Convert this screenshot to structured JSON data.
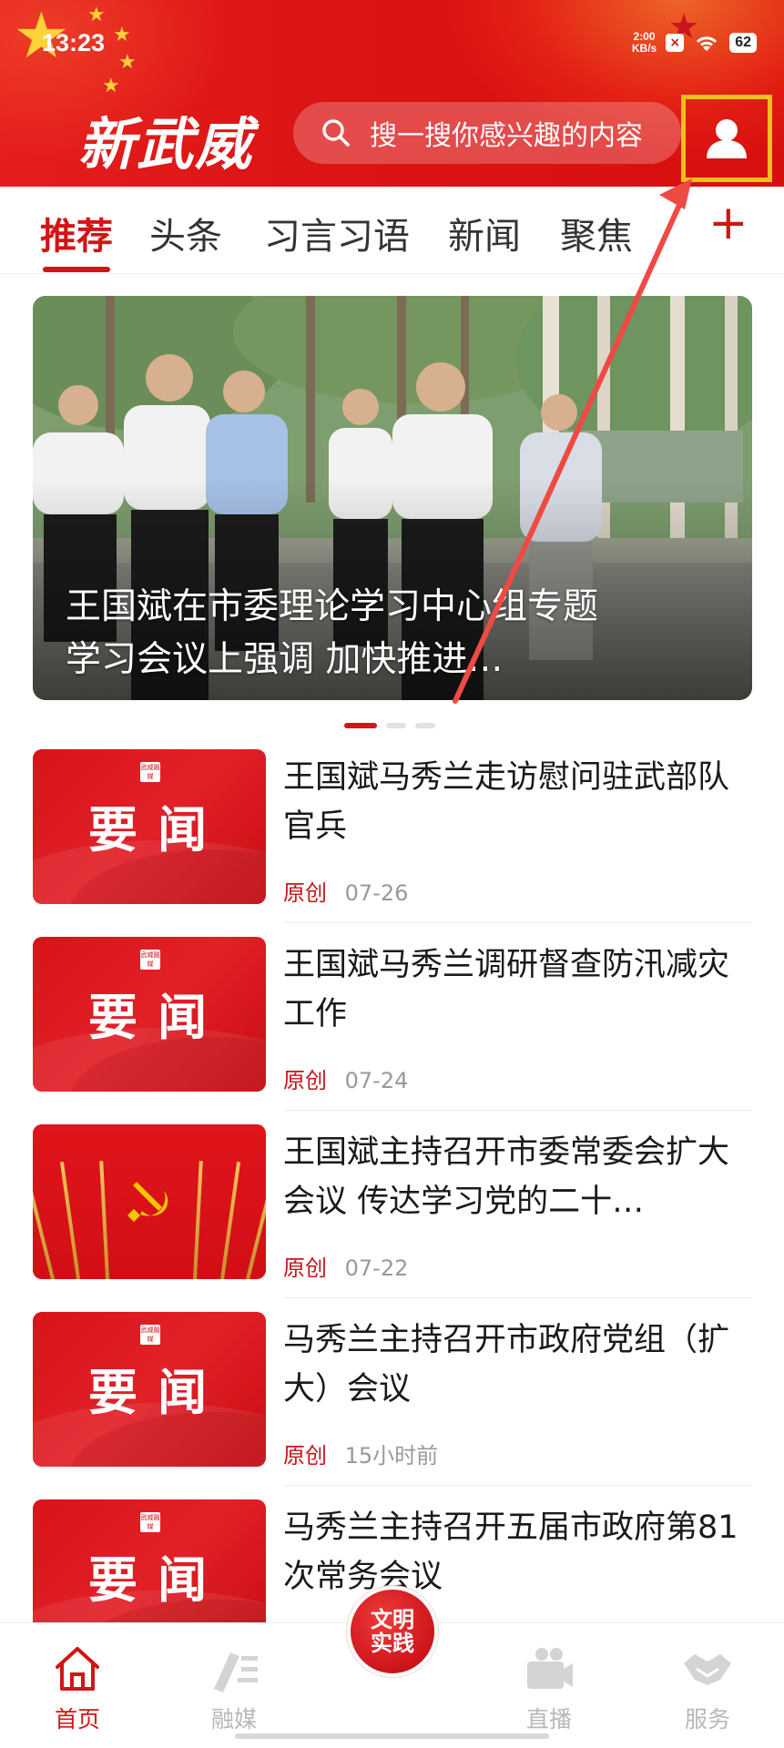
{
  "status_bar": {
    "time": "13:23",
    "network_speed_top": "2:00",
    "network_speed_unit": "KB/s",
    "battery": "62"
  },
  "header": {
    "logo_text": "新武威",
    "search_placeholder": "搜一搜你感兴趣的内容",
    "accent_color": "#d21515"
  },
  "tabs": [
    {
      "label": "推荐",
      "active": true
    },
    {
      "label": "头条",
      "active": false
    },
    {
      "label": "习言习语",
      "active": false
    },
    {
      "label": "新闻",
      "active": false
    },
    {
      "label": "聚焦",
      "active": false
    }
  ],
  "tabs_add_label": "+",
  "banner": {
    "title": "王国斌在市委理论学习中心组专题学习会议上强调  加快推进…",
    "page_index": 1,
    "page_count": 3
  },
  "news": [
    {
      "title": "王国斌马秀兰走访慰问驻武部队官兵",
      "source": "原创",
      "time": "07-26",
      "thumb_text": "要闻",
      "thumb_badge": "武威融媒",
      "thumb_type": "yaowen"
    },
    {
      "title": "王国斌马秀兰调研督查防汛减灾工作",
      "source": "原创",
      "time": "07-24",
      "thumb_text": "要闻",
      "thumb_badge": "武威融媒",
      "thumb_type": "yaowen"
    },
    {
      "title": "王国斌主持召开市委常委会扩大会议  传达学习党的二十…",
      "source": "原创",
      "time": "07-22",
      "thumb_text": "",
      "thumb_badge": "",
      "thumb_type": "party"
    },
    {
      "title": "马秀兰主持召开市政府党组（扩大）会议",
      "source": "原创",
      "time": "15小时前",
      "thumb_text": "要闻",
      "thumb_badge": "武威融媒",
      "thumb_type": "yaowen"
    },
    {
      "title": "马秀兰主持召开五届市政府第81次常务会议",
      "source": "",
      "time": "",
      "thumb_text": "要闻",
      "thumb_badge": "武威融媒",
      "thumb_type": "yaowen"
    }
  ],
  "bottom_nav": {
    "items": [
      {
        "label": "首页",
        "icon": "home-icon",
        "active": true
      },
      {
        "label": "融媒",
        "icon": "media-icon",
        "active": false
      },
      {
        "label": "直播",
        "icon": "live-icon",
        "active": false
      },
      {
        "label": "服务",
        "icon": "handshake-icon",
        "active": false
      }
    ],
    "center_button_text": "文明实践"
  }
}
